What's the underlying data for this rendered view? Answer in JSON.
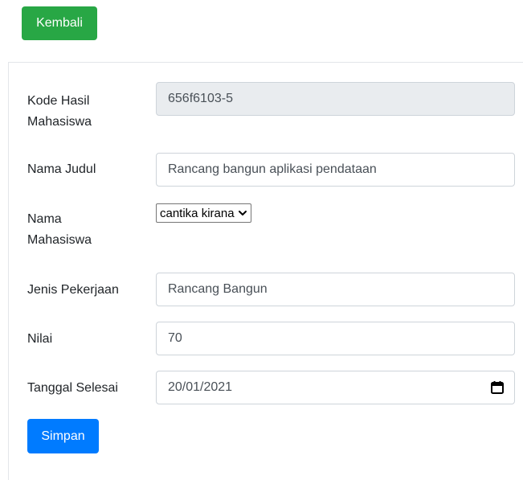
{
  "buttons": {
    "back_label": "Kembali",
    "save_label": "Simpan"
  },
  "form": {
    "kode_hasil_mahasiswa": {
      "label_line1": "Kode Hasil",
      "label_line2": "Mahasiswa",
      "value": "656f6103-5"
    },
    "nama_judul": {
      "label": "Nama Judul",
      "value": "Rancang bangun aplikasi pendataan"
    },
    "nama_mahasiswa": {
      "label_line1": "Nama",
      "label_line2": "Mahasiswa",
      "selected": "cantika kirana"
    },
    "jenis_pekerjaan": {
      "label": "Jenis Pekerjaan",
      "value": "Rancang Bangun"
    },
    "nilai": {
      "label": "Nilai",
      "value": "70"
    },
    "tanggal_selesai": {
      "label": "Tanggal Selesai",
      "value": "20/01/2021"
    }
  },
  "colors": {
    "back_button": "#28a745",
    "save_button": "#007bff",
    "readonly_background": "#e9ecef"
  },
  "icons": {
    "select_arrow": "chevron-down-icon",
    "date_picker": "calendar-icon"
  }
}
